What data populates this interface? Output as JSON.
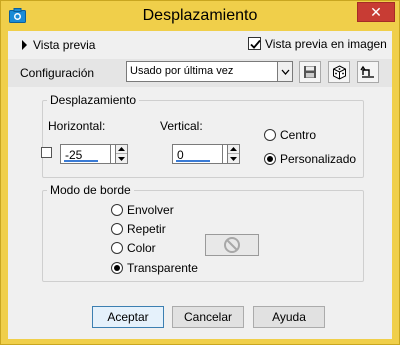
{
  "window": {
    "title": "Desplazamiento",
    "close_label": "✕"
  },
  "preview": {
    "toggle_label": "Vista previa",
    "in_image_label": "Vista previa en imagen",
    "in_image_checked": true
  },
  "config": {
    "label": "Configuración",
    "selected": "Usado por última vez",
    "tools": [
      "save-preset-icon",
      "dice-randomize-icon",
      "reset-default-icon"
    ]
  },
  "displacement": {
    "legend": "Desplazamiento",
    "horizontal_label": "Horizontal:",
    "horizontal_value": "-25",
    "vertical_label": "Vertical:",
    "vertical_value": "0",
    "link_checked": false,
    "options": [
      {
        "label": "Centro",
        "checked": false
      },
      {
        "label": "Personalizado",
        "checked": true
      }
    ]
  },
  "edge_mode": {
    "legend": "Modo de borde",
    "options": [
      {
        "label": "Envolver",
        "checked": false
      },
      {
        "label": "Repetir",
        "checked": false
      },
      {
        "label": "Color",
        "checked": false
      },
      {
        "label": "Transparente",
        "checked": true
      }
    ]
  },
  "buttons": {
    "ok": "Aceptar",
    "cancel": "Cancelar",
    "help": "Ayuda"
  }
}
